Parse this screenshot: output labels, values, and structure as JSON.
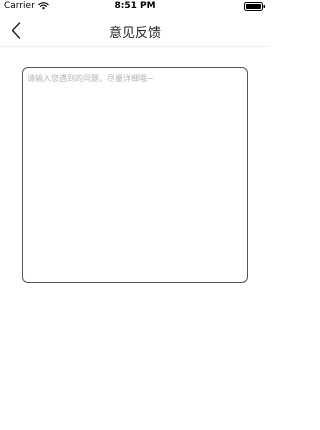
{
  "status_bar": {
    "carrier": "Carrier",
    "time": "8:51 PM",
    "wifi_icon": "wifi-icon",
    "battery_icon": "battery-icon"
  },
  "nav": {
    "back_icon": "chevron-left-icon",
    "title": "意见反馈"
  },
  "feedback": {
    "value": "",
    "placeholder": "请输入您遇到的问题，尽量详细哦~"
  },
  "colors": {
    "background": "#ffffff",
    "input_border": "#555555",
    "placeholder": "#b3b3b3",
    "title_text": "#222222"
  }
}
